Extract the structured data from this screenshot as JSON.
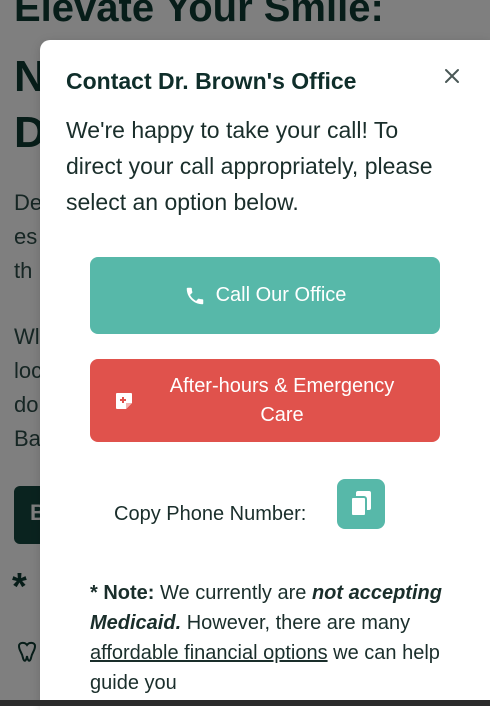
{
  "background": {
    "heading_line1": "Elevate Your Smile:",
    "heading_line2": "N",
    "heading_line3": "D",
    "para1_lines": [
      "De",
      "es",
      "th"
    ],
    "para2_lines": [
      "Wl",
      "loc",
      "do",
      "Ba"
    ],
    "button_label": "B",
    "star": "*"
  },
  "modal": {
    "title": "Contact Dr. Brown's Office",
    "close_icon": "close-icon",
    "intro": "We're happy to take your call! To direct your call appropriately, please select an option below.",
    "call_button": {
      "label": "Call Our Office",
      "icon": "phone-icon",
      "color": "#57b8a9"
    },
    "emergency_button": {
      "label": "After-hours & Emergency Care",
      "icon": "medical-note-icon",
      "color": "#e0524c"
    },
    "copy": {
      "label": "Copy Phone Number:",
      "icon": "copy-icon",
      "color": "#57b8a9"
    },
    "note": {
      "prefix": "* Note:",
      "text1": "We currently are",
      "emphasis": "not accepting Medicaid.",
      "text2": "However, there are many",
      "link": "affordable financial options",
      "text3": "we can help guide you"
    }
  }
}
